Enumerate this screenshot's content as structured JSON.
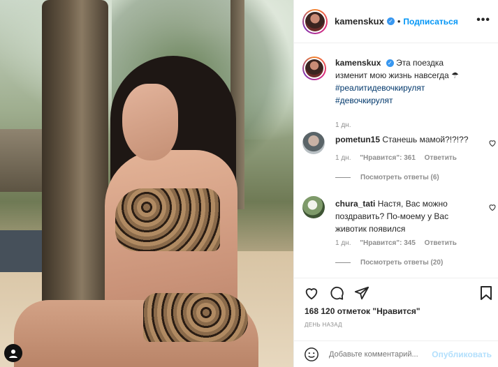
{
  "post": {
    "username": "kamenskux",
    "follow_label": "Подписаться",
    "more_label": "•••",
    "caption_text": "Эта поездка изменит мою жизнь навсегда ☂",
    "hashtags": [
      "#реалитидевочкирулят",
      "#девочкирулят"
    ],
    "caption_time": "1 дн."
  },
  "comments": [
    {
      "username": "pometun15",
      "text": "Станешь мамой?!?!??",
      "time": "1 дн.",
      "likes": "\"Нравится\": 361",
      "reply_label": "Ответить",
      "view_replies": "Посмотреть ответы (6)"
    },
    {
      "username": "chura_tati",
      "text": "Настя, Вас можно поздравить? По-моему у Вас животик появился",
      "time": "1 дн.",
      "likes": "\"Нравится\": 345",
      "reply_label": "Ответить",
      "view_replies": "Посмотреть ответы (20)"
    }
  ],
  "actions": {
    "likes_text": "168 120 отметок \"Нравится\"",
    "date_text": "ДЕНЬ НАЗАД"
  },
  "composer": {
    "placeholder": "Добавьте комментарий...",
    "publish_label": "Опубликовать"
  },
  "colors": {
    "accent": "#0095f6",
    "verified": "#3897f0",
    "muted": "#8e8e8e",
    "publish_disabled": "#b2dffc"
  },
  "icons": [
    "heart-icon",
    "comment-icon",
    "share-icon",
    "bookmark-icon",
    "emoji-icon",
    "verified-icon",
    "user-tag-icon"
  ]
}
